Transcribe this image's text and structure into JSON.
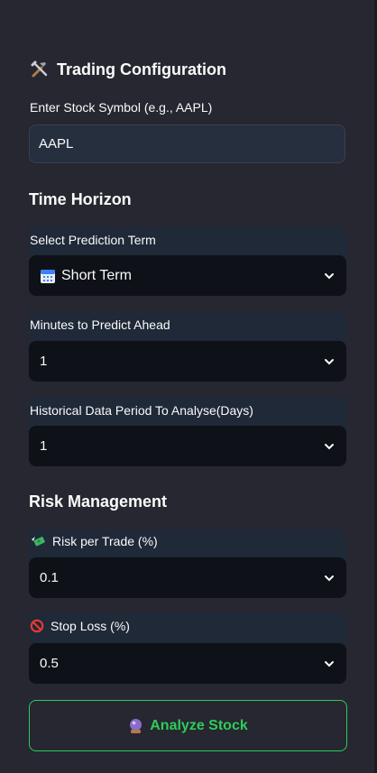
{
  "sidebar": {
    "title": "Trading Configuration",
    "title_icon": "tools-icon",
    "symbol_label": "Enter Stock Symbol (e.g., AAPL)",
    "symbol_value": "AAPL",
    "time_horizon": {
      "heading": "Time Horizon",
      "term_label": "Select Prediction Term",
      "term_icon": "calendar-icon",
      "term_value": "Short Term",
      "minutes_label": "Minutes to Predict Ahead",
      "minutes_value": "1",
      "history_label": "Historical Data Period To Analyse(Days)",
      "history_value": "1"
    },
    "risk": {
      "heading": "Risk Management",
      "risk_icon": "money-with-wings-icon",
      "risk_label": "Risk per Trade (%)",
      "risk_value": "0.1",
      "stop_icon": "prohibited-icon",
      "stop_label": "Stop Loss (%)",
      "stop_value": "0.5"
    },
    "analyze_button": {
      "icon": "crystal-ball-icon",
      "label": "Analyze Stock"
    },
    "colors": {
      "background": "#262730",
      "input_bg": "#0e1117",
      "accent_green": "#2ecc5a"
    }
  }
}
